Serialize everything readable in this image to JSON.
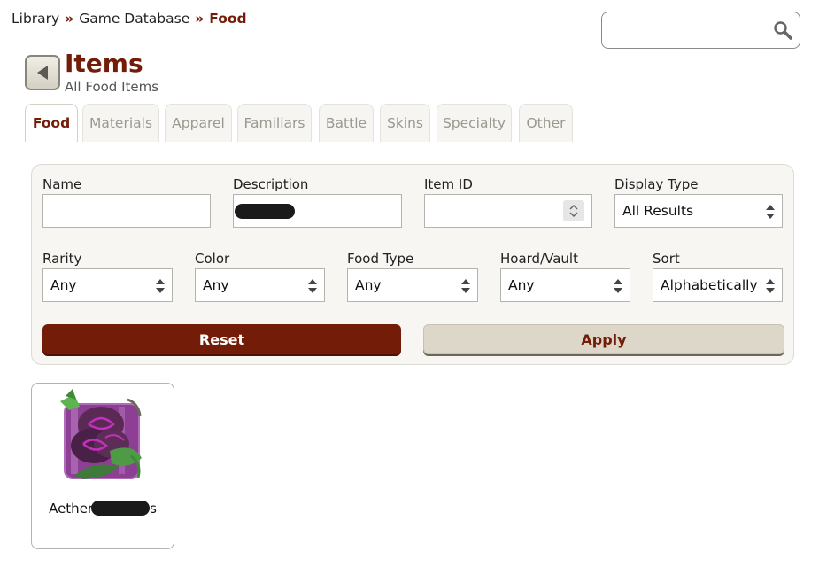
{
  "breadcrumb": {
    "items": [
      "Library",
      "Game Database"
    ],
    "separator": "»",
    "current": "Food"
  },
  "search": {
    "placeholder": "",
    "value": ""
  },
  "header": {
    "title": "Items",
    "subtitle": "All Food Items"
  },
  "tabs": [
    {
      "label": "Food",
      "active": true
    },
    {
      "label": "Materials",
      "active": false
    },
    {
      "label": "Apparel",
      "active": false
    },
    {
      "label": "Familiars",
      "active": false
    },
    {
      "label": "Battle",
      "active": false
    },
    {
      "label": "Skins",
      "active": false
    },
    {
      "label": "Specialty",
      "active": false
    },
    {
      "label": "Other",
      "active": false
    }
  ],
  "filters": {
    "name_label": "Name",
    "name_value": "",
    "description_label": "Description",
    "description_value": "",
    "item_id_label": "Item ID",
    "item_id_value": "",
    "display_type_label": "Display Type",
    "display_type_value": "All Results",
    "rarity_label": "Rarity",
    "rarity_value": "Any",
    "color_label": "Color",
    "color_value": "Any",
    "food_type_label": "Food Type",
    "food_type_value": "Any",
    "hoard_label": "Hoard/Vault",
    "hoard_value": "Any",
    "sort_label": "Sort",
    "sort_value": "Alphabetically"
  },
  "buttons": {
    "reset": "Reset",
    "apply": "Apply"
  },
  "results": [
    {
      "name_visible_start": "Aether",
      "name_visible_end": "s",
      "icon": "purple-flower-food-icon"
    }
  ],
  "colors": {
    "brand": "#731d08",
    "apply_bg": "#dcd7c9",
    "panel_bg": "#f7f6f3"
  }
}
